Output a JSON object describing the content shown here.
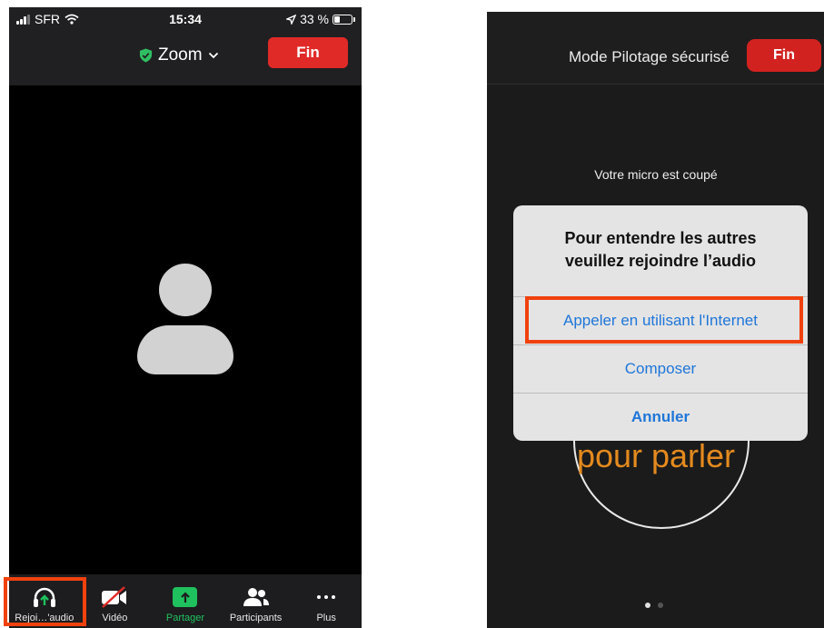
{
  "left_screen": {
    "status_bar": {
      "carrier": "SFR",
      "time": "15:34",
      "battery_percent": "33 %"
    },
    "header": {
      "meeting_name": "Zoom",
      "end_button": "Fin"
    },
    "toolbar": {
      "audio": "Rejoi…'audio",
      "video": "Vidéo",
      "share": "Partager",
      "participants": "Participants",
      "more": "Plus"
    }
  },
  "right_screen": {
    "header_title": "Mode Pilotage sécurisé",
    "end_button": "Fin",
    "mute_status": "Votre micro est coupé",
    "speak_hint": "pour parler",
    "dialog": {
      "title_line1": "Pour entendre les autres",
      "title_line2": "veuillez rejoindre l’audio",
      "option_internet": "Appeler en utilisant l'Internet",
      "option_dial": "Composer",
      "option_cancel": "Annuler"
    }
  },
  "colors": {
    "end_red": "#e02a27",
    "share_green": "#1fc15e",
    "link_blue": "#1e76d9",
    "highlight_orange": "#f0410e",
    "speak_orange": "#e48a1e"
  },
  "battery_level": 0.33
}
